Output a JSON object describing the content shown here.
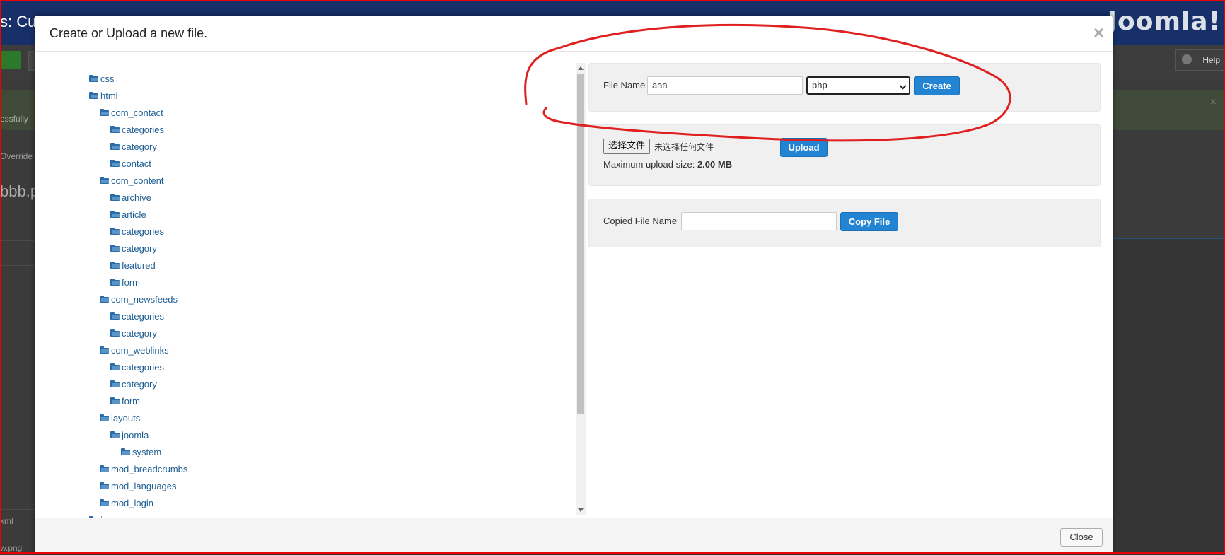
{
  "background": {
    "title_fragment": "s: Cu",
    "logo_text": "Joomla!",
    "help_label": "Help",
    "success_fragment": "essfully",
    "overrides_fragment": "Override",
    "file_fragment": "bbb.p",
    "left_labels": [
      "xml",
      "w.png"
    ]
  },
  "modal": {
    "title": "Create or Upload a new file.",
    "close_symbol": "×",
    "tree": [
      {
        "label": "css",
        "depth": 0
      },
      {
        "label": "html",
        "depth": 0
      },
      {
        "label": "com_contact",
        "depth": 1
      },
      {
        "label": "categories",
        "depth": 2
      },
      {
        "label": "category",
        "depth": 2
      },
      {
        "label": "contact",
        "depth": 2
      },
      {
        "label": "com_content",
        "depth": 1
      },
      {
        "label": "archive",
        "depth": 2
      },
      {
        "label": "article",
        "depth": 2
      },
      {
        "label": "categories",
        "depth": 2
      },
      {
        "label": "category",
        "depth": 2
      },
      {
        "label": "featured",
        "depth": 2
      },
      {
        "label": "form",
        "depth": 2
      },
      {
        "label": "com_newsfeeds",
        "depth": 1
      },
      {
        "label": "categories",
        "depth": 2
      },
      {
        "label": "category",
        "depth": 2
      },
      {
        "label": "com_weblinks",
        "depth": 1
      },
      {
        "label": "categories",
        "depth": 2
      },
      {
        "label": "category",
        "depth": 2
      },
      {
        "label": "form",
        "depth": 2
      },
      {
        "label": "layouts",
        "depth": 1
      },
      {
        "label": "joomla",
        "depth": 2
      },
      {
        "label": "system",
        "depth": 3
      },
      {
        "label": "mod_breadcrumbs",
        "depth": 1
      },
      {
        "label": "mod_languages",
        "depth": 1
      },
      {
        "label": "mod_login",
        "depth": 1
      },
      {
        "label": "images",
        "depth": 0
      }
    ],
    "create": {
      "label": "File Name",
      "value": "aaa",
      "type_selected": "php",
      "button": "Create"
    },
    "upload": {
      "choose_button": "选择文件",
      "no_file_text": "未选择任何文件",
      "button": "Upload",
      "max_size_label": "Maximum upload size: ",
      "max_size_value": "2.00 MB"
    },
    "copy": {
      "label": "Copied File Name",
      "value": "",
      "button": "Copy File"
    },
    "footer": {
      "close_button": "Close"
    }
  },
  "colors": {
    "annotation": "#e02020",
    "primary_button": "#2384d3",
    "folder_link": "#1f5e94"
  }
}
